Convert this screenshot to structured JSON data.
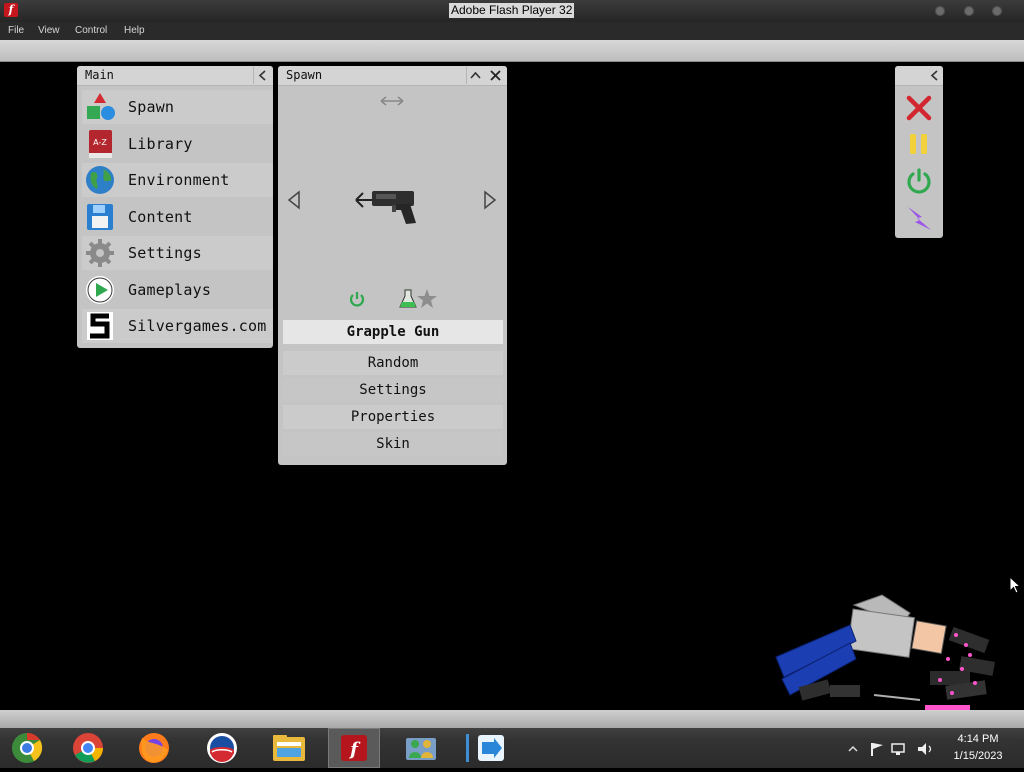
{
  "window": {
    "title": "Adobe Flash Player 32"
  },
  "menubar": {
    "items": [
      "File",
      "View",
      "Control",
      "Help"
    ]
  },
  "main_panel": {
    "title": "Main",
    "items": [
      {
        "label": "Spawn",
        "icon": "shapes-icon"
      },
      {
        "label": "Library",
        "icon": "book-icon"
      },
      {
        "label": "Environment",
        "icon": "globe-icon"
      },
      {
        "label": "Content",
        "icon": "floppy-icon"
      },
      {
        "label": "Settings",
        "icon": "gear-icon"
      },
      {
        "label": "Gameplays",
        "icon": "play-icon"
      },
      {
        "label": "Silvergames.com",
        "icon": "silvergames-logo-icon"
      }
    ]
  },
  "spawn_panel": {
    "title": "Spawn",
    "selected_item": "Grapple Gun",
    "buttons": [
      "Random",
      "Settings",
      "Properties",
      "Skin"
    ]
  },
  "control_panel": {
    "icons": [
      "close-red-icon",
      "pause-icon",
      "power-icon",
      "lightning-icon"
    ]
  },
  "taskbar": {
    "apps": [
      "chrome-old-icon",
      "chrome-icon",
      "firefox-icon",
      "obama-logo-icon",
      "file-explorer-icon",
      "flash-player-icon",
      "network-people-icon",
      "app-arrow-icon"
    ],
    "time": "4:14 PM",
    "date": "1/15/2023"
  },
  "colors": {
    "panel_bg": "#c4c4c4",
    "selected_bg": "#e6e6e6",
    "accent_green": "#2fa84f",
    "accent_red": "#d22630"
  }
}
